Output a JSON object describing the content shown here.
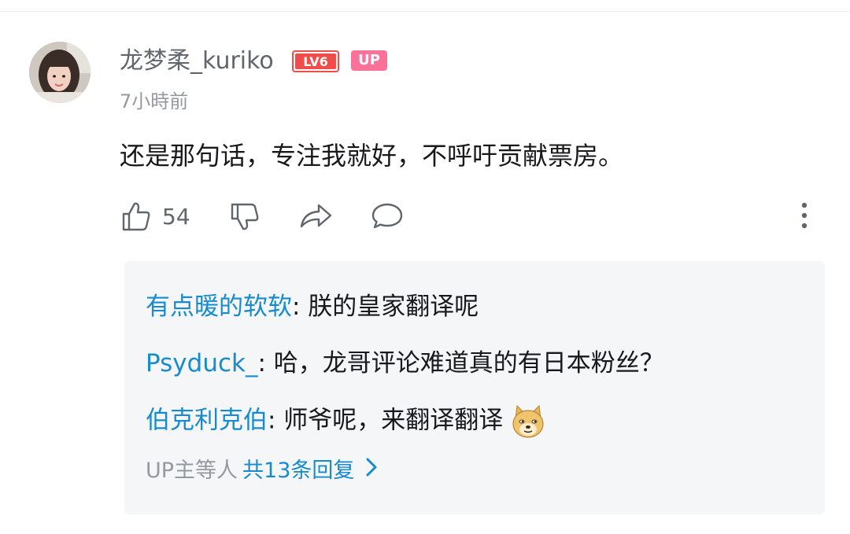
{
  "comment": {
    "username": "龙梦柔_kuriko",
    "level_badge": "LV6",
    "up_badge": "UP",
    "timestamp": "7小時前",
    "text": "还是那句话，专注我就好，不呼吁贡献票房。",
    "likes": "54"
  },
  "actions": {
    "like_icon": "thumbs-up-icon",
    "dislike_icon": "thumbs-down-icon",
    "share_icon": "share-icon",
    "reply_icon": "comment-bubble-icon",
    "more_icon": "more-vertical-icon"
  },
  "replies": [
    {
      "name": "有点暖的软软",
      "colon": ":",
      "text": " 朕的皇家翻译呢"
    },
    {
      "name": "Psyduck_",
      "colon": ":",
      "text": " 哈，龙哥评论难道真的有日本粉丝？"
    },
    {
      "name": "伯克利克伯",
      "colon": ":",
      "text": " 师爷呢，来翻译翻译",
      "emoji": "doge-emoji"
    }
  ],
  "more_replies": {
    "prefix": "UP主等人",
    "link": "共13条回复"
  },
  "colors": {
    "link_blue": "#178bcf",
    "up_pink": "#fb7299",
    "level_red": "#f04c49",
    "muted_gray": "#9499a0"
  }
}
